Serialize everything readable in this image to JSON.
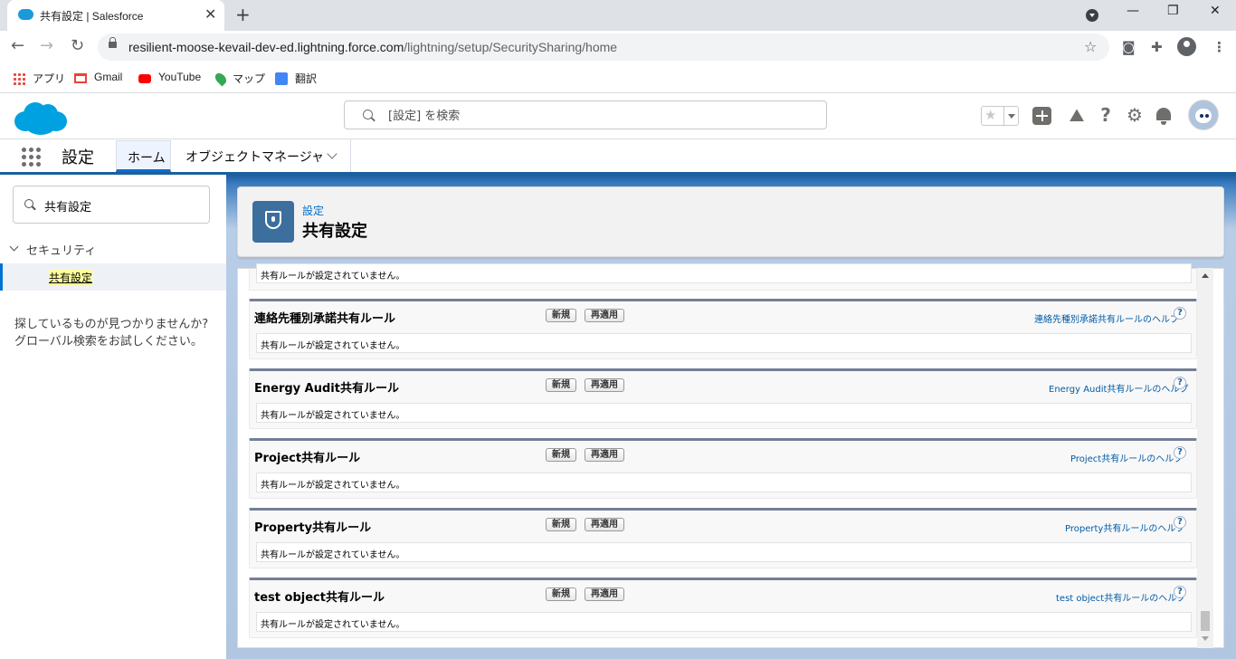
{
  "browser": {
    "tab_title": "共有設定 | Salesforce",
    "tab_close": "✕",
    "new_tab": "+",
    "url_host": "resilient-moose-kevail-dev-ed.lightning.force.com",
    "url_path": "/lightning/setup/SecuritySharing/home",
    "window_min": "—",
    "window_restore": "❐",
    "window_close": "✕",
    "bookmarks": [
      {
        "label": "アプリ",
        "icon": "apps-grid-icon"
      },
      {
        "label": "Gmail",
        "icon": "gmail-icon"
      },
      {
        "label": "YouTube",
        "icon": "youtube-icon"
      },
      {
        "label": "マップ",
        "icon": "maps-pin-icon"
      },
      {
        "label": "翻訳",
        "icon": "translate-icon"
      }
    ]
  },
  "header": {
    "search_placeholder": "[設定] を検索"
  },
  "nav": {
    "app_name": "設定",
    "home": "ホーム",
    "object_manager": "オブジェクトマネージャ"
  },
  "sidebar": {
    "quickfind_value": "共有設定",
    "section": "セキュリティ",
    "item": "共有設定",
    "not_found": "探しているものが見つかりませんか? グローバル検索をお試しください。"
  },
  "page": {
    "breadcrumb": "設定",
    "title": "共有設定"
  },
  "content": {
    "top_partial_text": "共有ルールが設定されていません。",
    "new_label": "新規",
    "reapply_label": "再適用",
    "help_symbol": "?",
    "blocks": [
      {
        "title": "連絡先種別承諾共有ルール",
        "help": "連絡先種別承諾共有ルールのヘルプ",
        "empty": "共有ルールが設定されていません。"
      },
      {
        "title": "Energy Audit共有ルール",
        "help": "Energy Audit共有ルールのヘルプ",
        "empty": "共有ルールが設定されていません。"
      },
      {
        "title": "Project共有ルール",
        "help": "Project共有ルールのヘルプ",
        "empty": "共有ルールが設定されていません。"
      },
      {
        "title": "Property共有ルール",
        "help": "Property共有ルールのヘルプ",
        "empty": "共有ルールが設定されていません。"
      },
      {
        "title": "test object共有ルール",
        "help": "test object共有ルールのヘルプ",
        "empty": "共有ルールが設定されていません。"
      }
    ]
  }
}
